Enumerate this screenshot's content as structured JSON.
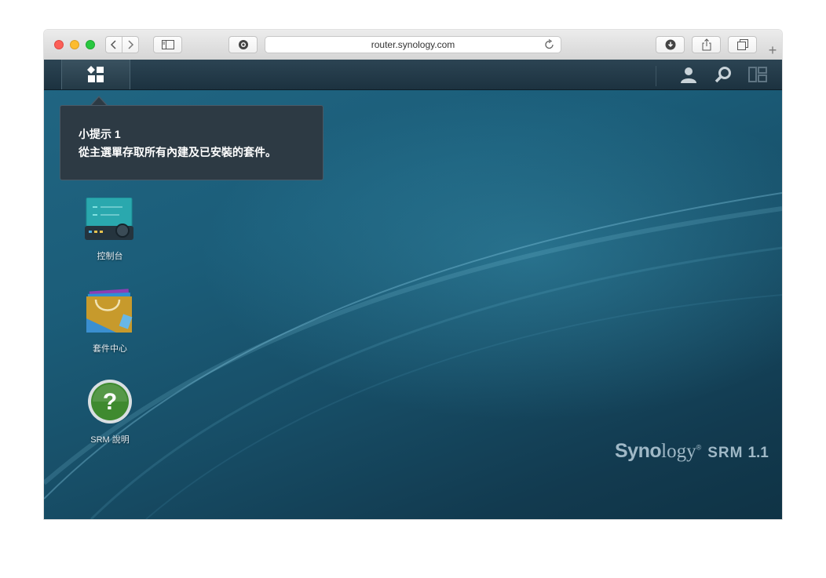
{
  "browser": {
    "url": "router.synology.com",
    "icons": [
      "back-icon",
      "forward-icon",
      "sidebar-icon",
      "privacy-icon",
      "reload-icon",
      "download-icon",
      "share-icon",
      "tabs-icon",
      "new-tab-icon"
    ]
  },
  "taskbar": {
    "icons": [
      "main-menu-icon",
      "user-icon",
      "search-icon",
      "widgets-icon"
    ]
  },
  "tooltip": {
    "title": "小提示 1",
    "text": "從主選單存取所有內建及已安裝的套件。"
  },
  "desktop_icons": [
    {
      "label": "控制台",
      "icon": "control-panel-icon"
    },
    {
      "label": "套件中心",
      "icon": "package-center-icon"
    },
    {
      "label": "SRM 說明",
      "icon": "help-icon"
    }
  ],
  "branding": {
    "brand_a": "Syno",
    "brand_b": "logy",
    "product": "SRM",
    "version": "1.1"
  },
  "colors": {
    "desktop_bg": "#1b5d79",
    "taskbar_bg": "#243a47",
    "tooltip_bg": "#2d3a44",
    "accent_green": "#3f8a2f"
  }
}
